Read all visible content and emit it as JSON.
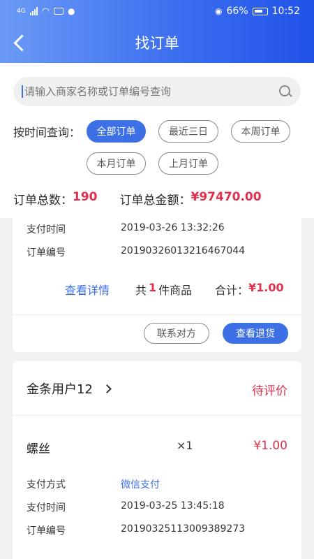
{
  "status": {
    "time": "10:52",
    "battery": "66%",
    "signal": "4G"
  },
  "nav": {
    "title": "找订单"
  },
  "search": {
    "placeholder": "请输入商家名称或订单编号查询"
  },
  "filter": {
    "label": "按时间查询：",
    "chips": [
      "全部订单",
      "最近三日",
      "本周订单",
      "本月订单",
      "上月订单"
    ],
    "active": "全部订单"
  },
  "summary": {
    "count_label": "订单总数：",
    "count": "190",
    "amount_label": "订单总金额：",
    "amount": "¥97470.00"
  },
  "orders": [
    {
      "pay_time_label": "支付时间",
      "pay_time": "2019-03-26 13:32:26",
      "order_no_label": "订单编号",
      "order_no": "20190326013216467044",
      "detail_link": "查看详情",
      "qty_prefix": "共",
      "qty": "1",
      "qty_suffix": "件商品",
      "total_label": "合计：",
      "total": "¥1.00",
      "contact_button": "联系对方",
      "refund_button": "查看退货"
    },
    {
      "shop": "金条用户12",
      "status": "待评价",
      "item_name": "螺丝",
      "item_qty": "×1",
      "item_price": "¥1.00",
      "pay_method_label": "支付方式",
      "pay_method": "微信支付",
      "pay_time_label": "支付时间",
      "pay_time": "2019-03-25 13:45:18",
      "order_no_label": "订单编号",
      "order_no": "20190325113009389273"
    }
  ]
}
